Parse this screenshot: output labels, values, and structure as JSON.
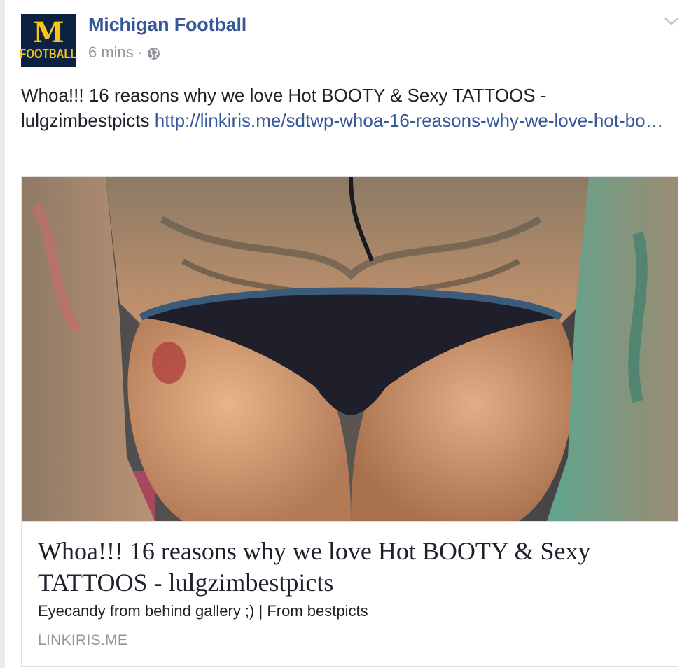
{
  "post": {
    "page_name": "Michigan Football",
    "time": "6 mins",
    "separator": "·",
    "privacy_icon": "globe-icon",
    "menu_icon": "chevron-down-icon",
    "avatar": {
      "logo_letter": "M",
      "logo_text": "FOOTBALL",
      "bg": "#0d2140",
      "fg": "#f5c518"
    },
    "status_text": "Whoa!!! 16 reasons why we love Hot BOOTY & Sexy TATTOOS - lulgzimbestpicts ",
    "status_link": "http://linkiris.me/sdtwp-whoa-16-reasons-why-we-love-hot-bo…"
  },
  "link_card": {
    "image": "photo",
    "title": "Whoa!!! 16 reasons why we love Hot BOOTY & Sexy TATTOOS - lulgzimbestpicts",
    "description": "Eyecandy from behind gallery ;) | From bestpicts",
    "domain": "LINKIRIS.ME"
  },
  "colors": {
    "link": "#365899",
    "meta": "#90949c",
    "text": "#1d2129",
    "border": "#dddfe2"
  }
}
